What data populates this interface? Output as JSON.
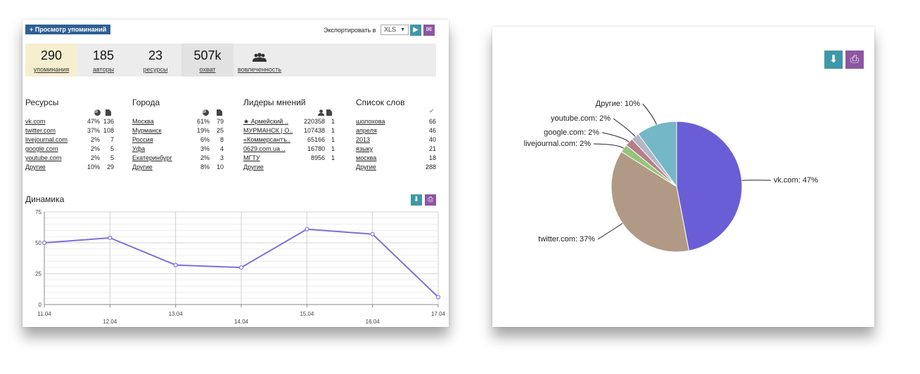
{
  "toolbar": {
    "view_button": "+ Просмотр упоминаний",
    "export_label": "Экспортировать в",
    "export_format": "XLS",
    "go_icon": "play-icon",
    "email_icon": "envelope-icon"
  },
  "stats": [
    {
      "value": "290",
      "label": "упоминания"
    },
    {
      "value": "185",
      "label": "авторы"
    },
    {
      "value": "23",
      "label": "ресурсы"
    },
    {
      "value": "507k",
      "label": "охват"
    },
    {
      "value": "",
      "label": "вовлеченность"
    }
  ],
  "resources": {
    "title": "Ресурсы",
    "rows": [
      {
        "name": "vk.com",
        "pct": "47%",
        "count": "136"
      },
      {
        "name": "twitter.com",
        "pct": "37%",
        "count": "108"
      },
      {
        "name": "livejournal.com",
        "pct": "2%",
        "count": "7"
      },
      {
        "name": "google.com",
        "pct": "2%",
        "count": "5"
      },
      {
        "name": "youtube.com",
        "pct": "2%",
        "count": "5"
      },
      {
        "name": "Другие",
        "pct": "10%",
        "count": "29"
      }
    ]
  },
  "cities": {
    "title": "Города",
    "rows": [
      {
        "name": "Москва",
        "pct": "61%",
        "count": "79"
      },
      {
        "name": "Мурманск",
        "pct": "19%",
        "count": "25"
      },
      {
        "name": "Россия",
        "pct": "6%",
        "count": "8"
      },
      {
        "name": "Уфа",
        "pct": "3%",
        "count": "4"
      },
      {
        "name": "Екатеринбург",
        "pct": "2%",
        "count": "3"
      },
      {
        "name": "Другие",
        "pct": "8%",
        "count": "10"
      }
    ]
  },
  "leaders": {
    "title": "Лидеры мнений",
    "rows": [
      {
        "name": "★ Армейский ..",
        "reach": "220358",
        "count": "1"
      },
      {
        "name": "МУРМАНСК | О..",
        "reach": "107438",
        "count": "1"
      },
      {
        "name": "«Коммерсантъ..",
        "reach": "65166",
        "count": "1"
      },
      {
        "name": "0629.com.ua ..",
        "reach": "16780",
        "count": "1"
      },
      {
        "name": "МГТУ",
        "reach": "8956",
        "count": "1"
      },
      {
        "name": "Другие",
        "reach": "",
        "count": ""
      }
    ]
  },
  "words": {
    "title": "Список слов",
    "rows": [
      {
        "name": "шолохова",
        "count": "66"
      },
      {
        "name": "апреля",
        "count": "46"
      },
      {
        "name": "2013",
        "count": "40"
      },
      {
        "name": "языку",
        "count": "21"
      },
      {
        "name": "москва",
        "count": "18"
      },
      {
        "name": "Другие",
        "count": "288"
      }
    ]
  },
  "dynamics_title": "Динамика",
  "colors": {
    "line": "#7b6fdb",
    "teal": "#3e98a7",
    "purple": "#8c56a2",
    "header_button": "#2f5f92"
  },
  "chart_data": [
    {
      "type": "line",
      "title": "Динамика",
      "x": [
        "11.04",
        "12.04",
        "13.04",
        "14.04",
        "15.04",
        "16.04",
        "17.04"
      ],
      "series": [
        {
          "values": [
            50,
            54,
            32,
            30,
            61,
            57,
            6
          ]
        }
      ],
      "yticks": [
        "0",
        "25",
        "50",
        "75"
      ],
      "ylim": [
        0,
        75
      ],
      "grid": true,
      "color": "#7b6fdb"
    },
    {
      "type": "pie",
      "labels": [
        "vk.com: 47%",
        "twitter.com: 37%",
        "livejournal.com: 2%",
        "google.com: 2%",
        "youtube.com: 2%",
        "Другие: 10%"
      ],
      "values": [
        47,
        37,
        2,
        2,
        2,
        10
      ],
      "colors": [
        "#6a5ed6",
        "#b09a85",
        "#95c47a",
        "#b57f8a",
        "#b3b6c4",
        "#74b7c6"
      ]
    }
  ]
}
